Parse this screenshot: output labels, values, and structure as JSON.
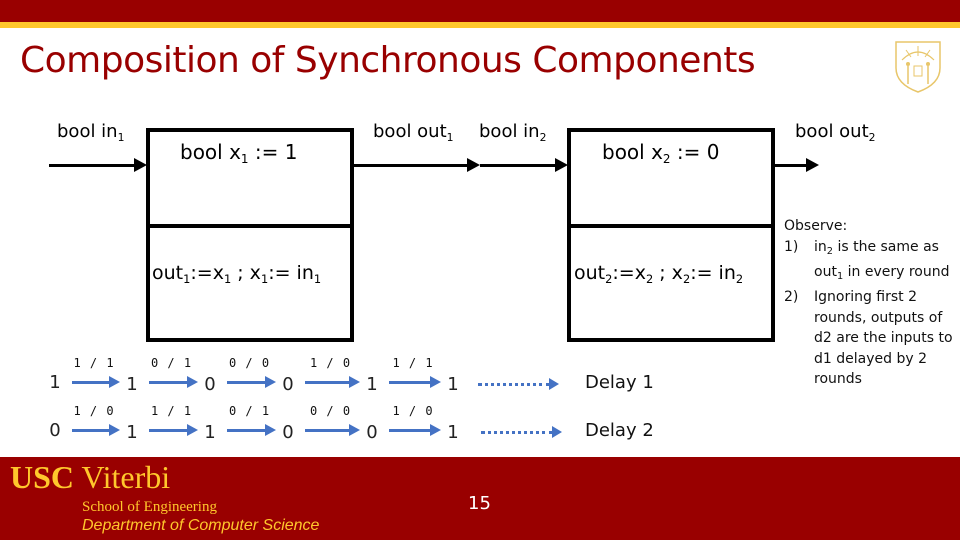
{
  "slide": {
    "title": "Composition of Synchronous Components",
    "page_number": "15",
    "colors": {
      "cardinal": "#990000",
      "gold": "#FFC72C",
      "arrow_blue": "#4472C4"
    }
  },
  "diagram": {
    "component1": {
      "input_label": {
        "text": "bool in",
        "sub": "1"
      },
      "state_decl": {
        "text": "bool x",
        "sub": "1",
        "rest": " := 1"
      },
      "update": {
        "out": "out",
        "out_sub": "1",
        "assign1": ":=x",
        "x_sub1": "1",
        "sep": " ; x",
        "x_sub2": "1",
        "assign2": ":= in",
        "in_sub": "1"
      },
      "output_label": {
        "text": "bool out",
        "sub": "1"
      }
    },
    "component2": {
      "input_label": {
        "text": "bool in",
        "sub": "2"
      },
      "state_decl": {
        "text": "bool x",
        "sub": "2",
        "rest": " := 0"
      },
      "update": {
        "out": "out",
        "out_sub": "2",
        "assign1": ":=x",
        "x_sub1": "2",
        "sep": " ; x",
        "x_sub2": "2",
        "assign2": ":= in",
        "in_sub": "2"
      },
      "output_label": {
        "text": "bool out",
        "sub": "2"
      }
    }
  },
  "executions": [
    {
      "name": "Delay 1",
      "states": [
        "1",
        "1",
        "0",
        "0",
        "1",
        "1"
      ],
      "transitions": [
        "1 / 1",
        "0 / 1",
        "0 / 0",
        "1 / 0",
        "1 / 1"
      ]
    },
    {
      "name": "Delay 2",
      "states": [
        "0",
        "1",
        "1",
        "0",
        "0",
        "1"
      ],
      "transitions": [
        "1 / 0",
        "1 / 1",
        "0 / 1",
        "0 / 0",
        "1 / 0"
      ]
    }
  ],
  "observations": {
    "heading": "Observe:",
    "items": [
      {
        "num": "1)",
        "parts": [
          "in",
          "2",
          " is the same as out",
          "1",
          " in every round"
        ]
      },
      {
        "num": "2)",
        "text": "Ignoring first 2 rounds, outputs of d2 are the inputs to d1 delayed by 2 rounds"
      }
    ]
  },
  "footer": {
    "usc": "USC",
    "viterbi": "Viterbi",
    "school": "School of Engineering",
    "department": "Department of Computer Science"
  },
  "icons": {
    "seal": "usc-seal-icon"
  }
}
